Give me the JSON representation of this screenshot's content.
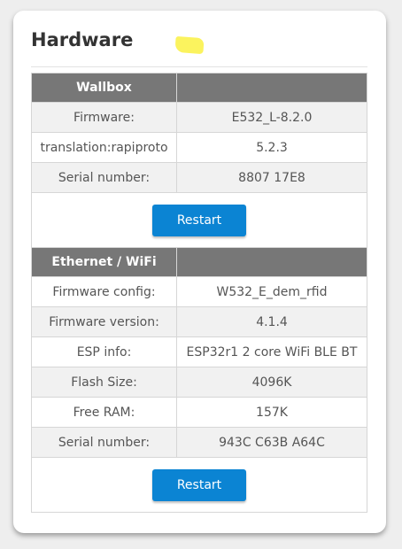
{
  "page": {
    "title": "Hardware",
    "accent_color": "#0b84d3",
    "header_color": "#777777"
  },
  "wallbox": {
    "header": "Wallbox",
    "rows": [
      {
        "label": "Firmware:",
        "value": "E532_L-8.2.0"
      },
      {
        "label": "translation:rapiproto",
        "value": "5.2.3"
      },
      {
        "label": "Serial number:",
        "value": "8807 17E8"
      }
    ],
    "restart_label": "Restart"
  },
  "ethernet": {
    "header": "Ethernet / WiFi",
    "rows": [
      {
        "label": "Firmware config:",
        "value": "W532_E_dem_rfid"
      },
      {
        "label": "Firmware version:",
        "value": "4.1.4"
      },
      {
        "label": "ESP info:",
        "value": "ESP32r1 2 core WiFi BLE BT"
      },
      {
        "label": "Flash Size:",
        "value": "4096K"
      },
      {
        "label": "Free RAM:",
        "value": "157K"
      },
      {
        "label": "Serial number:",
        "value": "943C C63B A64C"
      }
    ],
    "restart_label": "Restart"
  }
}
